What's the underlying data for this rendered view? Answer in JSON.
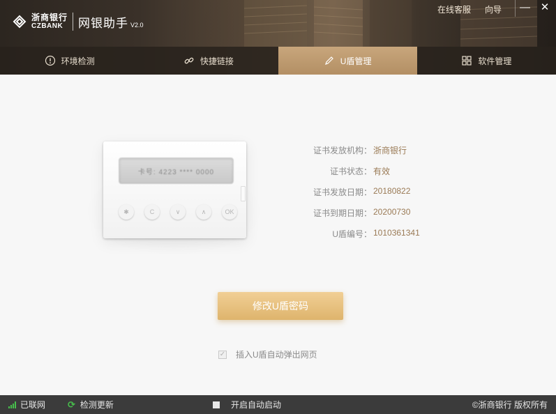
{
  "header": {
    "logo_cn": "浙商银行",
    "logo_en": "CZBANK",
    "app_title": "网银助手",
    "app_version": "V2.0",
    "links": [
      {
        "label": "在线客服"
      },
      {
        "label": "向导"
      }
    ],
    "minimize_glyph": "—",
    "close_glyph": "✕"
  },
  "tabs": [
    {
      "label": "环境检测",
      "icon": "info-icon",
      "active": false
    },
    {
      "label": "快捷链接",
      "icon": "link-icon",
      "active": false
    },
    {
      "label": "U盾管理",
      "icon": "pen-icon",
      "active": true
    },
    {
      "label": "软件管理",
      "icon": "grid-icon",
      "active": false
    }
  ],
  "device": {
    "screen_text": "卡号: 4223 **** 0000",
    "keys": [
      "✱",
      "C",
      "∨",
      "∧",
      "OK"
    ]
  },
  "certificate": [
    {
      "label": "证书发放机构：",
      "value": "浙商银行"
    },
    {
      "label": "证书状态：",
      "value": "有效"
    },
    {
      "label": "证书发放日期：",
      "value": "20180822"
    },
    {
      "label": "证书到期日期：",
      "value": "20200730"
    },
    {
      "label": "U盾编号：",
      "value": "1010361341"
    }
  ],
  "change_password_button": "修改U盾密码",
  "auto_popup": {
    "label": "插入U盾自动弹出网页",
    "checked": true,
    "check_glyph": "✓"
  },
  "footer": {
    "network_status": "已联网",
    "check_update": "检测更新",
    "autostart": "开启自动启动",
    "copyright": "©浙商银行 版权所有"
  },
  "colors": {
    "accent_gold": "#deb46d",
    "value_brown": "#9a7a55",
    "online_green": "#47c04c"
  }
}
